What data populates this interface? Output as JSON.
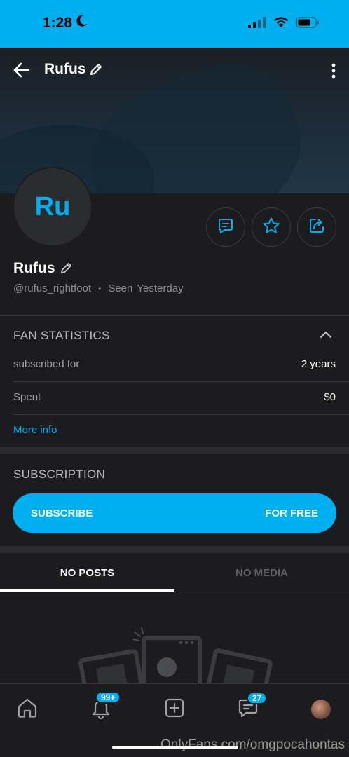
{
  "status_bar": {
    "time": "1:28",
    "icons": [
      "moon-icon",
      "signal-icon",
      "wifi-icon",
      "battery-icon"
    ]
  },
  "header": {
    "title": "Rufus"
  },
  "profile": {
    "avatar_initials": "Ru",
    "name": "Rufus",
    "handle": "@rufus_rightfoot",
    "separator": "•",
    "seen_label": "Seen",
    "seen_value": "Yesterday"
  },
  "fan_statistics": {
    "title": "FAN STATISTICS",
    "rows": [
      {
        "label": "subscribed for",
        "value": "2 years"
      },
      {
        "label": "Spent",
        "value": "$0"
      }
    ],
    "more_info": "More info"
  },
  "subscription": {
    "title": "SUBSCRIPTION",
    "button_left": "SUBSCRIBE",
    "button_right": "FOR FREE"
  },
  "tabs": [
    {
      "label": "NO POSTS",
      "active": true
    },
    {
      "label": "NO MEDIA",
      "active": false
    }
  ],
  "bottom_nav": {
    "notifications_badge": "99+",
    "messages_badge": "27"
  },
  "watermark": "OnlyFans.com/omgpocahontas",
  "colors": {
    "accent": "#00aff0",
    "background": "#1c1c1e",
    "muted_text": "#8a8d93"
  }
}
